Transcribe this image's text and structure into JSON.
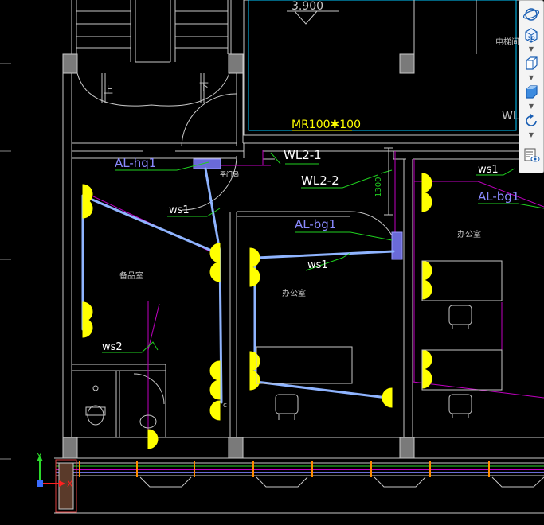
{
  "drawing": {
    "elevation": "3.900",
    "beam_label": "MR100✱100",
    "elevator_room": "电梯间",
    "wl_partial": "WL",
    "wl2_1": "WL2-1",
    "wl2_2": "WL2-2",
    "dim_1300": "1300",
    "panel_hq1": "AL-hq1",
    "panel_bg1_mid": "AL-bg1",
    "panel_bg1_right": "AL-bg1",
    "ws1_left": "ws1",
    "ws1_mid": "ws1",
    "ws1_right": "ws1",
    "ws2": "ws2",
    "room_storage": "备品室",
    "room_office_mid": "办公室",
    "room_office_right": "办公室",
    "stair_up": "上",
    "stair_down": "下",
    "fire_door": "平门局",
    "mark_c": "c"
  },
  "colors": {
    "background": "#000000",
    "wall": "#c8c8c8",
    "cable": "#8fb4ff",
    "outlet": "#ffff00",
    "leader": "#1fd01f",
    "magenta": "#c000c0",
    "panel": "#6a6ad8",
    "cyan": "#00c8ff",
    "beam_text": "#ffff00"
  },
  "toolbar": {
    "tools": [
      {
        "name": "orbit",
        "icon": "orbit-icon"
      },
      {
        "name": "3d-view",
        "icon": "cube-3d-icon"
      },
      {
        "name": "view-cube",
        "icon": "view-cube-icon"
      },
      {
        "name": "shaded-cube",
        "icon": "shaded-cube-icon"
      },
      {
        "name": "rotate",
        "icon": "rotate-icon"
      },
      {
        "name": "properties",
        "icon": "list-eye-icon"
      }
    ]
  },
  "ucs": {
    "x": "X",
    "y": "Y"
  }
}
